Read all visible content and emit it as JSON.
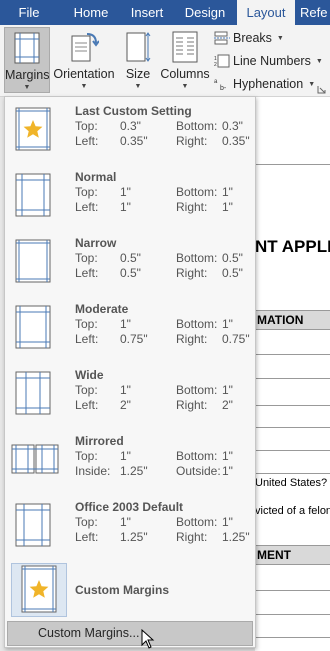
{
  "tabs": [
    {
      "label": "File"
    },
    {
      "label": "Home"
    },
    {
      "label": "Insert"
    },
    {
      "label": "Design"
    },
    {
      "label": "Layout"
    },
    {
      "label": "Refe"
    }
  ],
  "ribbon": {
    "margins_label": "Margins",
    "orientation_label": "Orientation",
    "size_label": "Size",
    "columns_label": "Columns",
    "breaks_label": "Breaks",
    "line_numbers_label": "Line Numbers",
    "hyphenation_label": "Hyphenation"
  },
  "document": {
    "heading": "NT APPLI",
    "section1": "MATION",
    "question1": "United States?",
    "question2": "victed of a felon",
    "section2": "MENT"
  },
  "margins_menu": {
    "items": [
      {
        "name": "Last Custom Setting",
        "r1_l": "Top:",
        "r1_lv": "0.3\"",
        "r1_r": "Bottom:",
        "r1_rv": "0.3\"",
        "r2_l": "Left:",
        "r2_lv": "0.35\"",
        "r2_r": "Right:",
        "r2_rv": "0.35\""
      },
      {
        "name": "Normal",
        "r1_l": "Top:",
        "r1_lv": "1\"",
        "r1_r": "Bottom:",
        "r1_rv": "1\"",
        "r2_l": "Left:",
        "r2_lv": "1\"",
        "r2_r": "Right:",
        "r2_rv": "1\""
      },
      {
        "name": "Narrow",
        "r1_l": "Top:",
        "r1_lv": "0.5\"",
        "r1_r": "Bottom:",
        "r1_rv": "0.5\"",
        "r2_l": "Left:",
        "r2_lv": "0.5\"",
        "r2_r": "Right:",
        "r2_rv": "0.5\""
      },
      {
        "name": "Moderate",
        "r1_l": "Top:",
        "r1_lv": "1\"",
        "r1_r": "Bottom:",
        "r1_rv": "1\"",
        "r2_l": "Left:",
        "r2_lv": "0.75\"",
        "r2_r": "Right:",
        "r2_rv": "0.75\""
      },
      {
        "name": "Wide",
        "r1_l": "Top:",
        "r1_lv": "1\"",
        "r1_r": "Bottom:",
        "r1_rv": "1\"",
        "r2_l": "Left:",
        "r2_lv": "2\"",
        "r2_r": "Right:",
        "r2_rv": "2\""
      },
      {
        "name": "Mirrored",
        "r1_l": "Top:",
        "r1_lv": "1\"",
        "r1_r": "Bottom:",
        "r1_rv": "1\"",
        "r2_l": "Inside:",
        "r2_lv": "1.25\"",
        "r2_r": "Outside:",
        "r2_rv": "1\""
      },
      {
        "name": "Office 2003 Default",
        "r1_l": "Top:",
        "r1_lv": "1\"",
        "r1_r": "Bottom:",
        "r1_rv": "1\"",
        "r2_l": "Left:",
        "r2_lv": "1.25\"",
        "r2_r": "Right:",
        "r2_rv": "1.25\""
      }
    ],
    "custom_margins": "Custom Margins",
    "custom_margins_button": "Custom Margins..."
  },
  "colors": {
    "ribbon_blue": "#2b579a",
    "star_gold": "#f0b429",
    "selected_gray": "#c5c5c5"
  },
  "icons": [
    "margins-icon",
    "orientation-icon",
    "size-icon",
    "columns-icon",
    "breaks-icon",
    "line-numbers-icon",
    "hyphenation-icon",
    "star-icon",
    "mouse-cursor-icon"
  ]
}
